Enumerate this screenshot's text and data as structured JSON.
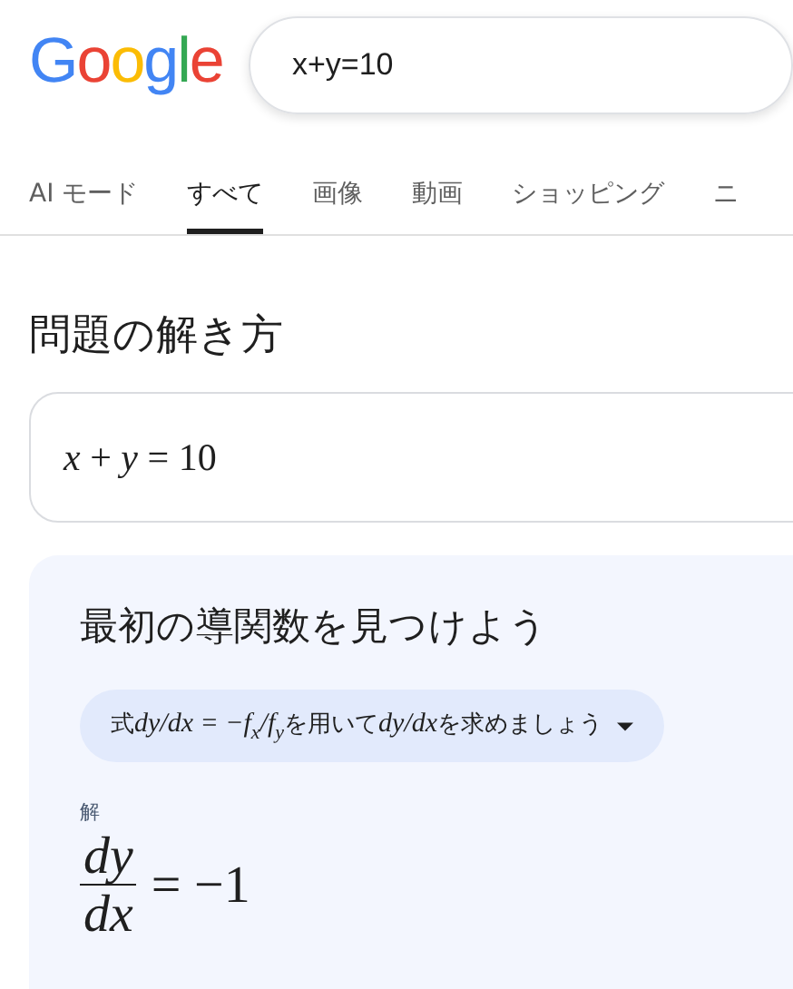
{
  "logo": "Google",
  "search": {
    "value": "x+y=10"
  },
  "tabs": [
    {
      "label": "AI モード",
      "selected": false
    },
    {
      "label": "すべて",
      "selected": true
    },
    {
      "label": "画像",
      "selected": false
    },
    {
      "label": "動画",
      "selected": false
    },
    {
      "label": "ショッピング",
      "selected": false
    },
    {
      "label": "ニ",
      "selected": false
    }
  ],
  "heading": "問題の解き方",
  "problem": "*x* + *y* = 10",
  "solution": {
    "title": "最初の導関数を見つけよう",
    "step": [
      {
        "kind": "text",
        "text": "式"
      },
      {
        "kind": "math",
        "text": "dy/dx = −f$_{x}$/f$_{y}$"
      },
      {
        "kind": "text",
        "text": "を用いて"
      },
      {
        "kind": "math",
        "text": "dy/dx"
      },
      {
        "kind": "text",
        "text": "を求めましょう"
      }
    ],
    "answer_label": "解",
    "answer": {
      "numerator": "dy",
      "denominator": "dx",
      "rhs": "= −1"
    }
  }
}
